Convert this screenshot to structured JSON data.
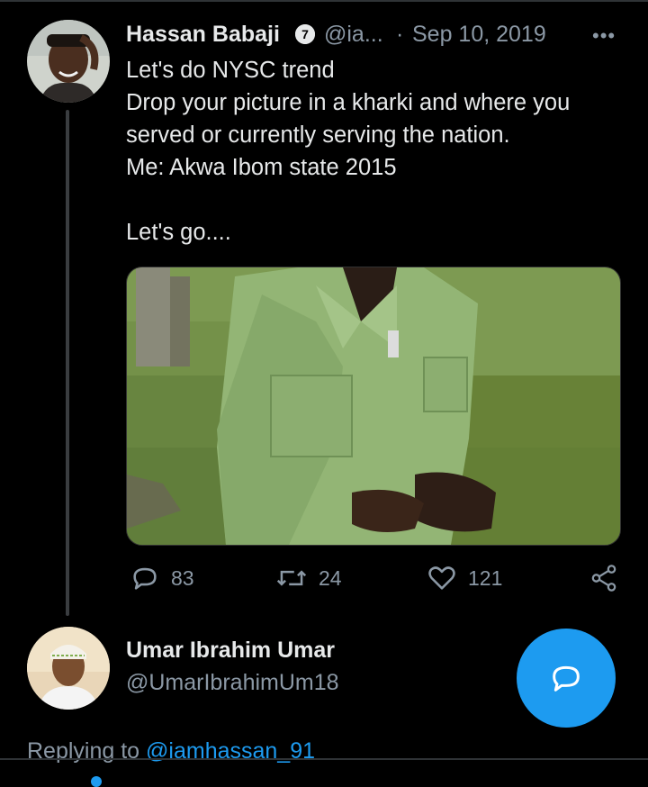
{
  "tweet": {
    "author_name": "Hassan Babaji",
    "handle": "@ia...",
    "separator": "·",
    "date": "Sep 10, 2019",
    "more": "•••",
    "text_lines": [
      "Let's do NYSC trend",
      "Drop your picture in a kharki and where you",
      "served or currently serving the nation.",
      "Me: Akwa Ibom state 2015",
      "",
      "Let's go...."
    ],
    "stats": {
      "replies": "83",
      "retweets": "24",
      "likes": "121"
    }
  },
  "reply_author": {
    "name": "Umar Ibrahim Umar",
    "handle": "@UmarIbrahimUm18"
  },
  "replying": {
    "prefix": "Replying to",
    "mention": "@iamhassan_91"
  },
  "colors": {
    "background": "#000000",
    "accent": "#1d9bf0",
    "muted": "#8b98a5",
    "text": "#e7e9ea"
  },
  "icons": [
    "reply-icon",
    "retweet-icon",
    "like-icon",
    "share-icon",
    "compose-icon",
    "verified-badge-icon"
  ]
}
